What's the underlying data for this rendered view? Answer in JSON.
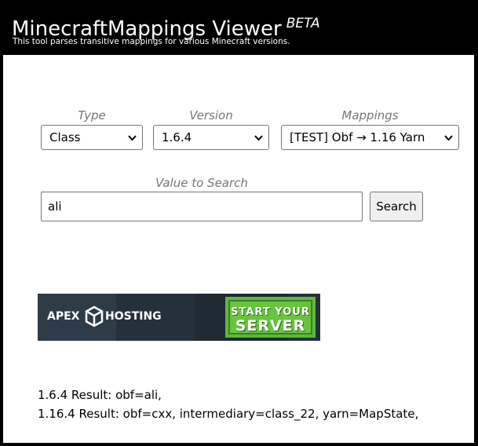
{
  "header": {
    "title": "MinecraftMappings Viewer",
    "badge": "BETA",
    "subtitle": "This tool parses transitive mappings for various Minecraft versions."
  },
  "form": {
    "type_label": "Type",
    "type_value": "Class",
    "version_label": "Version",
    "version_value": "1.6.4",
    "mappings_label": "Mappings",
    "mappings_value": "[TEST] Obf → 1.16 Yarn",
    "search_label": "Value to Search",
    "search_value": "ali",
    "search_button": "Search"
  },
  "ad": {
    "brand_left": "APEX",
    "brand_right": "HOSTING",
    "cta_line1": "START YOUR",
    "cta_line2": "SERVER",
    "colors": {
      "cta": "#67c43e",
      "banner": "#24303c"
    }
  },
  "results": [
    "1.6.4 Result: obf=ali,",
    "1.16.4 Result: obf=cxx, intermediary=class_22, yarn=MapState,"
  ]
}
